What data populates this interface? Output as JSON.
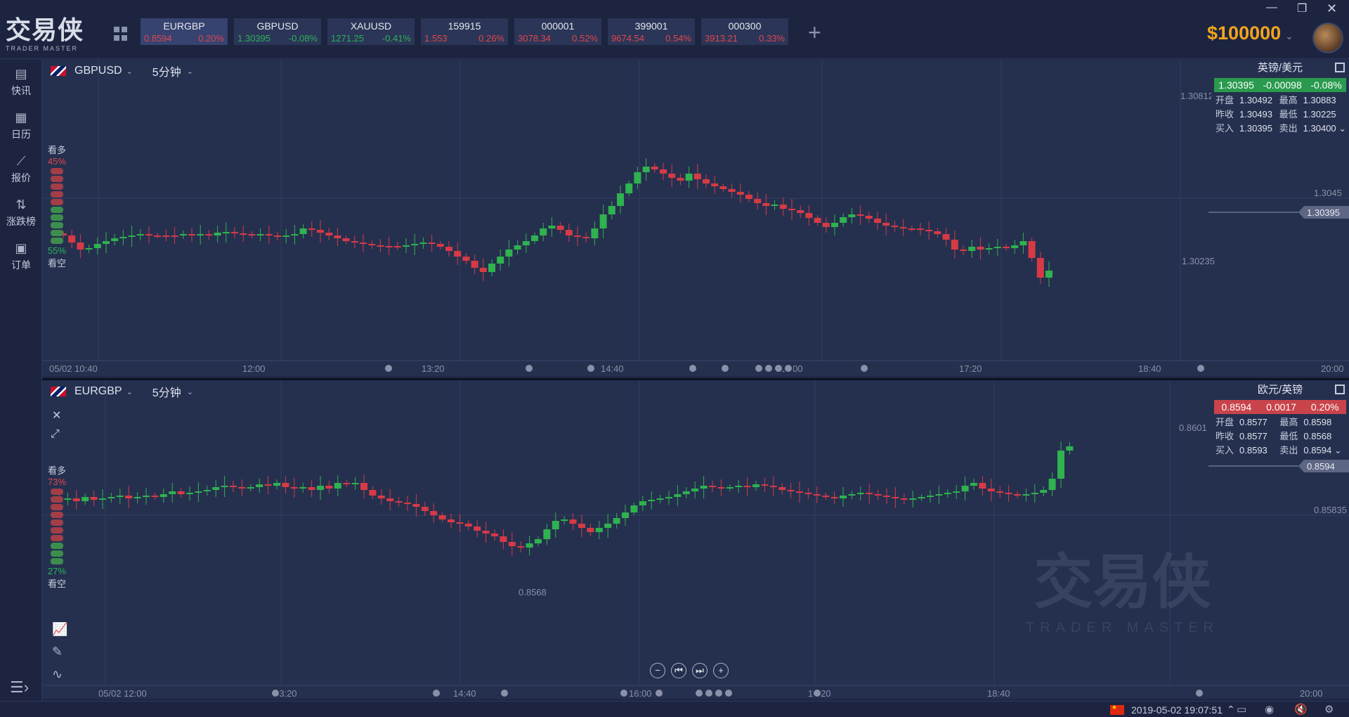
{
  "app": {
    "logo_cn": "交易侠",
    "logo_en": "TRADER MASTER",
    "balance_symbol": "$",
    "balance": "100000"
  },
  "tickers": [
    {
      "symbol": "EURGBP",
      "price": "0.8594",
      "change": "0.20%",
      "dir": "dn",
      "active": true
    },
    {
      "symbol": "GBPUSD",
      "price": "1.30395",
      "change": "-0.08%",
      "dir": "up",
      "active": false
    },
    {
      "symbol": "XAUUSD",
      "price": "1271.25",
      "change": "-0.41%",
      "dir": "up",
      "active": false
    },
    {
      "symbol": "159915",
      "price": "1.553",
      "change": "0.26%",
      "dir": "dn",
      "active": false
    },
    {
      "symbol": "000001",
      "price": "3078.34",
      "change": "0.52%",
      "dir": "dn",
      "active": false
    },
    {
      "symbol": "399001",
      "price": "9674.54",
      "change": "0.54%",
      "dir": "dn",
      "active": false
    },
    {
      "symbol": "000300",
      "price": "3913.21",
      "change": "0.33%",
      "dir": "dn",
      "active": false
    }
  ],
  "sidebar": {
    "items": [
      {
        "label": "快讯",
        "icon": "news-icon"
      },
      {
        "label": "日历",
        "icon": "calendar-icon"
      },
      {
        "label": "报价",
        "icon": "quote-icon"
      },
      {
        "label": "涨跌榜",
        "icon": "ranking-icon"
      },
      {
        "label": "订单",
        "icon": "order-icon"
      }
    ]
  },
  "panel1": {
    "symbol": "GBPUSD",
    "interval": "5分钟",
    "sentiment": {
      "bull_label": "看多",
      "bull_pct": "45%",
      "bear_label": "看空",
      "bear_pct": "55%",
      "bull_fraction": 0.45
    },
    "info": {
      "title": "英镑/美元",
      "price": "1.30395",
      "change": "-0.00098",
      "change_pct": "-0.08%",
      "open_label": "开盘",
      "open": "1.30492",
      "high_label": "最高",
      "high": "1.30883",
      "prev_label": "昨收",
      "prev": "1.30493",
      "low_label": "最低",
      "low": "1.30225",
      "bid_label": "买入",
      "bid": "1.30395",
      "ask_label": "卖出",
      "ask": "1.30400"
    },
    "time_labels": [
      "05/02 10:40",
      "12:00",
      "13:20",
      "14:40",
      "16:00",
      "17:20",
      "18:40",
      "20:00"
    ],
    "price_labels": {
      "high_mark": "1.30812",
      "low_mark": "1.30235",
      "grid_level": "1.3045",
      "last": "1.30395"
    }
  },
  "panel2": {
    "symbol": "EURGBP",
    "interval": "5分钟",
    "sentiment": {
      "bull_label": "看多",
      "bull_pct": "73%",
      "bear_label": "看空",
      "bear_pct": "27%",
      "bull_fraction": 0.73
    },
    "info": {
      "title": "欧元/英镑",
      "price": "0.8594",
      "change": "0.0017",
      "change_pct": "0.20%",
      "open_label": "开盘",
      "open": "0.8577",
      "high_label": "最高",
      "high": "0.8598",
      "prev_label": "昨收",
      "prev": "0.8577",
      "low_label": "最低",
      "low": "0.8568",
      "bid_label": "买入",
      "bid": "0.8593",
      "ask_label": "卖出",
      "ask": "0.8594"
    },
    "time_labels": [
      "05/02 12:00",
      "13:20",
      "14:40",
      "16:00",
      "17:20",
      "18:40",
      "20:00"
    ],
    "price_labels": {
      "high_mark": "0.8601",
      "low_mark": "0.8568",
      "grid_level": "0.85835",
      "last": "0.8594"
    },
    "watermark_cn": "交易侠",
    "watermark_en": "TRADER MASTER"
  },
  "status": {
    "datetime": "2019-05-02 19:07:51"
  },
  "colors": {
    "up": "#29b35a",
    "down": "#e0464f",
    "accent": "#f2a51c",
    "background": "#25304f"
  }
}
